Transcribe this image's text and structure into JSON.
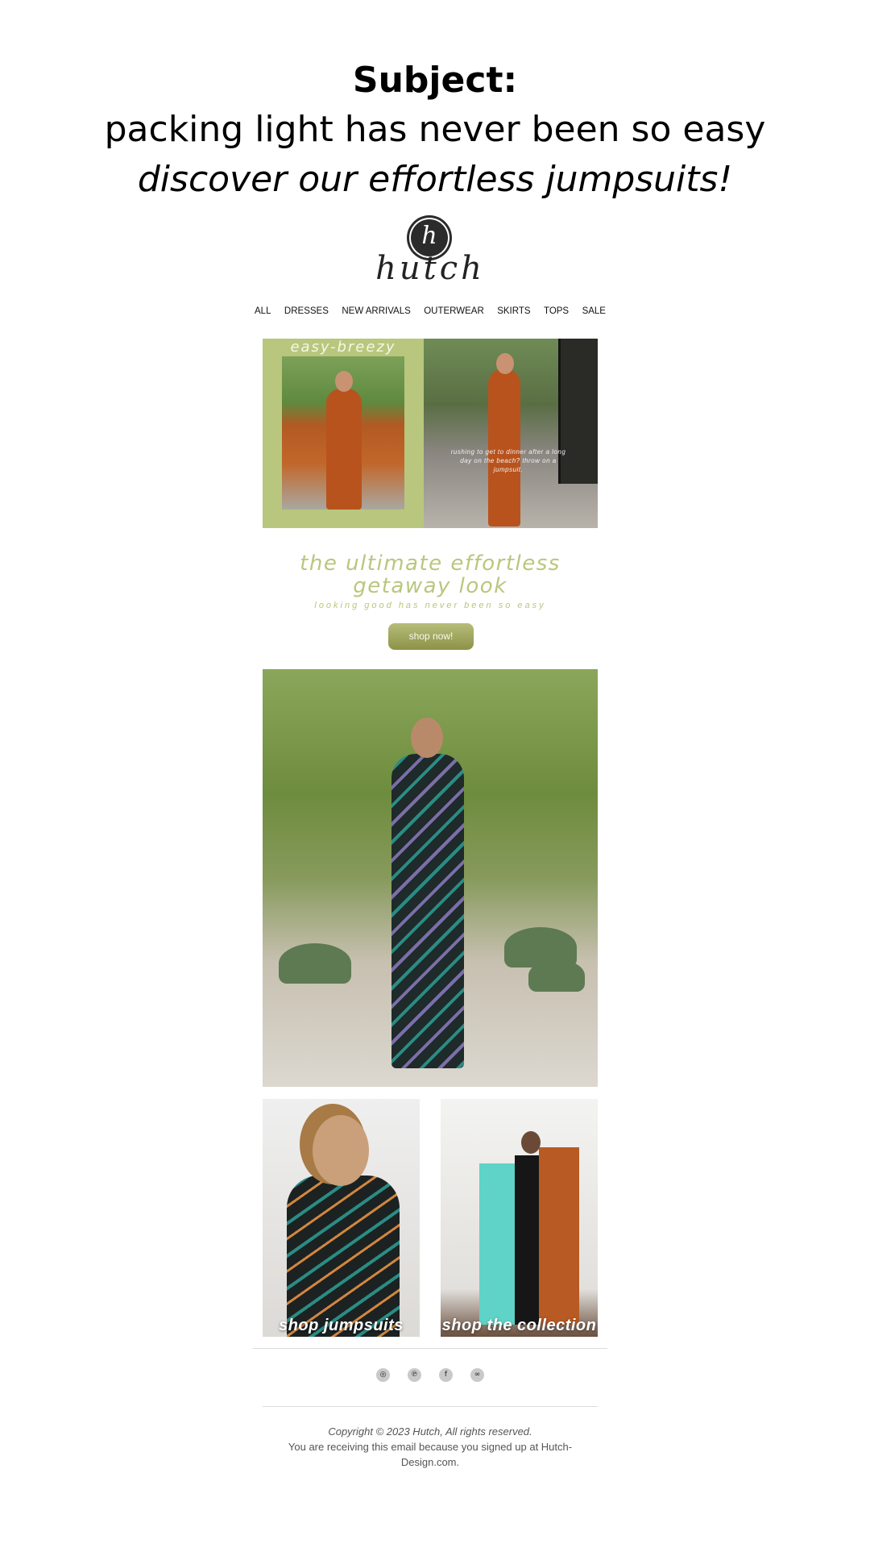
{
  "subject": {
    "label": "Subject:",
    "line1": "packing light has never been so easy",
    "line2": "discover our effortless jumpsuits!"
  },
  "brand": {
    "monogram": "h",
    "name": "hutch"
  },
  "nav": {
    "items": [
      "ALL",
      "DRESSES",
      "NEW ARRIVALS",
      "OUTERWEAR",
      "SKIRTS",
      "TOPS",
      "SALE"
    ]
  },
  "hero": {
    "left_title": "easy-breezy",
    "right_caption": "rushing to get to dinner after a long day on the beach? throw on a jumpsuit.",
    "accent_color": "#b8c77d"
  },
  "promo": {
    "headline_line1": "the ultimate effortless",
    "headline_line2": "getaway look",
    "tagline": "looking good has never been so easy",
    "cta_label": "shop now!"
  },
  "tiles": {
    "left_label": "shop jumpsuits",
    "right_label": "shop the collection"
  },
  "social": {
    "icons": [
      "instagram-icon",
      "pinterest-icon",
      "facebook-icon",
      "link-icon"
    ],
    "glyphs": [
      "◎",
      "℗",
      "f",
      "∞"
    ]
  },
  "footer": {
    "copyright": "Copyright © 2023 Hutch, All rights reserved.",
    "notice": "You are receiving this email because you signed up at Hutch-Design.com."
  }
}
